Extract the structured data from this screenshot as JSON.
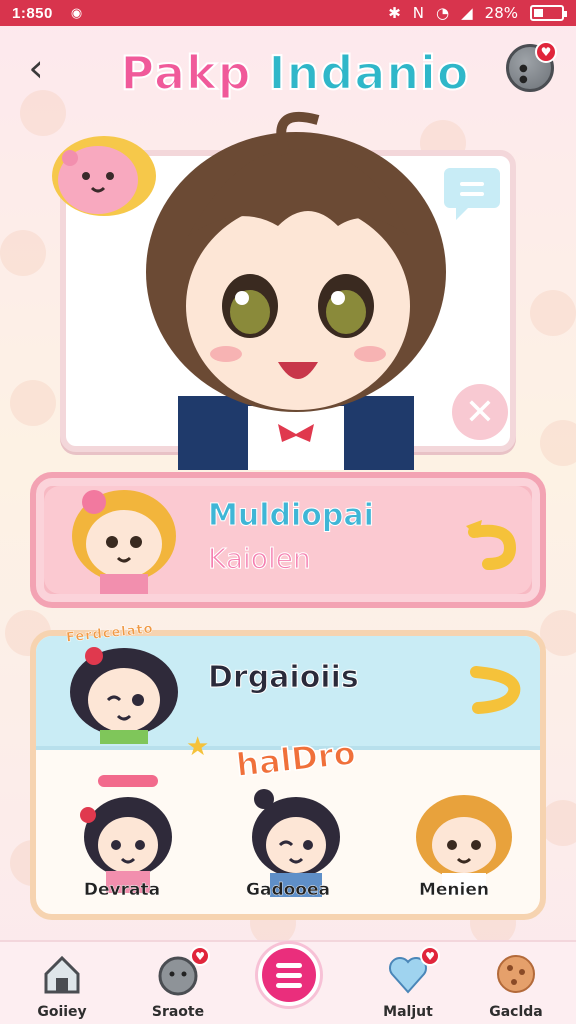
{
  "status_bar": {
    "time": "1:850",
    "battery": "28%"
  },
  "header": {
    "title_part1": "Pakp",
    "title_part2": "Indanio"
  },
  "cards": {
    "primary": {
      "title": "Muldiopai",
      "subtitle": "Kaiolen"
    },
    "secondary": {
      "title": "Drgaioiis",
      "badge_text": "Ferdcelato",
      "sticker_text": "halDro",
      "friends": [
        {
          "name": "Devrata"
        },
        {
          "name": "Gadooea"
        },
        {
          "name": "Menien"
        }
      ]
    }
  },
  "bottom_nav": {
    "items": [
      {
        "label": "Goiiey"
      },
      {
        "label": "Sraote"
      },
      {
        "label": "Maljut"
      },
      {
        "label": "Gaclda"
      }
    ]
  },
  "colors": {
    "status_bar": "#d8344d",
    "accent_pink": "#ea2e7c",
    "card_pink": "#f7b9c3",
    "card_blue": "#c9ecf5",
    "arrow_yellow": "#f5c23a"
  }
}
